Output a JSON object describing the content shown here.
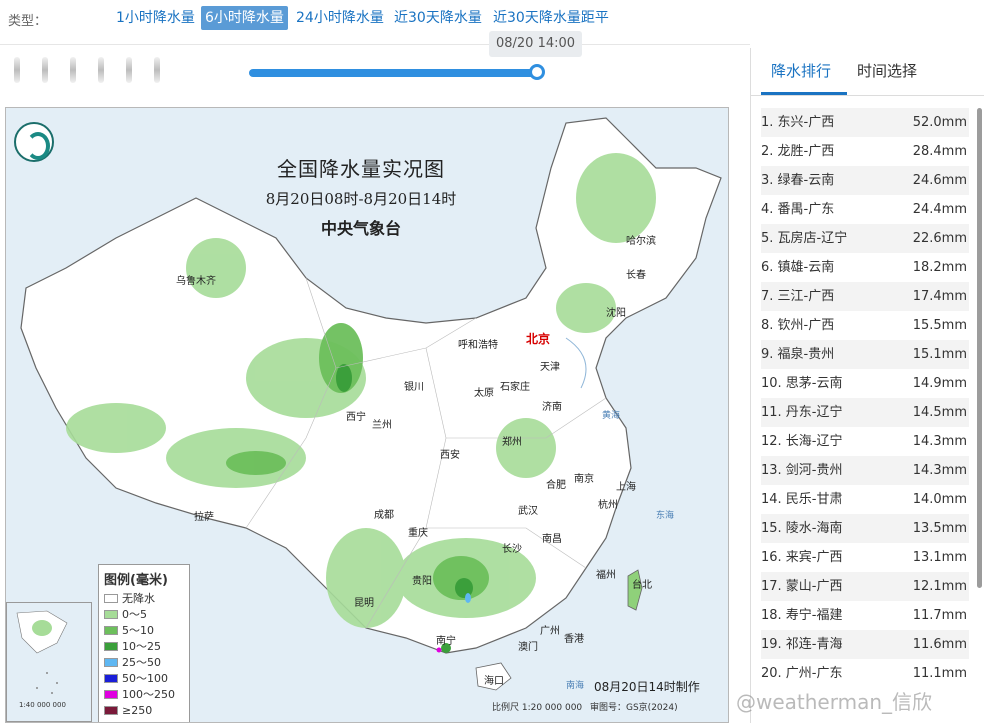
{
  "type_bar": {
    "label": "类型：",
    "tabs": [
      {
        "label": "1小时降水量",
        "active": false
      },
      {
        "label": "6小时降水量",
        "active": true
      },
      {
        "label": "24小时降水量",
        "active": false
      },
      {
        "label": "近30天降水量",
        "active": false
      },
      {
        "label": "近30天降水量距平",
        "active": false
      }
    ]
  },
  "timeline": {
    "current_time": "08/20 14:00"
  },
  "map": {
    "title": "全国降水量实况图",
    "subtitle": "8月20日08时-8月20日14时",
    "org": "中央气象台",
    "capital": "北京",
    "cities": [
      "乌鲁木齐",
      "哈尔滨",
      "长春",
      "沈阳",
      "呼和浩特",
      "天津",
      "银川",
      "太原",
      "石家庄",
      "西宁",
      "兰州",
      "济南",
      "郑州",
      "西安",
      "合肥",
      "南京",
      "上海",
      "拉萨",
      "成都",
      "武汉",
      "杭州",
      "重庆",
      "南昌",
      "长沙",
      "贵阳",
      "福州",
      "台北",
      "昆明",
      "南宁",
      "广州",
      "香港",
      "澳门",
      "海口"
    ],
    "seas": [
      "黄海",
      "东海",
      "南海"
    ],
    "legend": {
      "title": "图例(毫米)",
      "items": [
        {
          "label": "无降水",
          "color": "#ffffff"
        },
        {
          "label": "0～5",
          "color": "#a6dc98"
        },
        {
          "label": "5～10",
          "color": "#6dbf5c"
        },
        {
          "label": "10～25",
          "color": "#3b9f3b"
        },
        {
          "label": "25～50",
          "color": "#5fb7f2"
        },
        {
          "label": "50～100",
          "color": "#1a1ed8"
        },
        {
          "label": "100～250",
          "color": "#e000e0"
        },
        {
          "label": "≥250",
          "color": "#7a1a3a"
        }
      ]
    },
    "footer_note": "08月20日14时制作",
    "scale_text": "比例尺 1:20 000 000",
    "approval": "审图号：GS京(2024)",
    "inset_scale": "1:40 000 000"
  },
  "panel": {
    "tabs": [
      {
        "label": "降水排行",
        "active": true
      },
      {
        "label": "时间选择",
        "active": false
      }
    ],
    "ranking": [
      {
        "name": "1. 东兴-广西",
        "value": "52.0mm"
      },
      {
        "name": "2. 龙胜-广西",
        "value": "28.4mm"
      },
      {
        "name": "3. 绿春-云南",
        "value": "24.6mm"
      },
      {
        "name": "4. 番禺-广东",
        "value": "24.4mm"
      },
      {
        "name": "5. 瓦房店-辽宁",
        "value": "22.6mm"
      },
      {
        "name": "6. 镇雄-云南",
        "value": "18.2mm"
      },
      {
        "name": "7. 三江-广西",
        "value": "17.4mm"
      },
      {
        "name": "8. 钦州-广西",
        "value": "15.5mm"
      },
      {
        "name": "9. 福泉-贵州",
        "value": "15.1mm"
      },
      {
        "name": "10. 思茅-云南",
        "value": "14.9mm"
      },
      {
        "name": "11. 丹东-辽宁",
        "value": "14.5mm"
      },
      {
        "name": "12. 长海-辽宁",
        "value": "14.3mm"
      },
      {
        "name": "13. 剑河-贵州",
        "value": "14.3mm"
      },
      {
        "name": "14. 民乐-甘肃",
        "value": "14.0mm"
      },
      {
        "name": "15. 陵水-海南",
        "value": "13.5mm"
      },
      {
        "name": "16. 来宾-广西",
        "value": "13.1mm"
      },
      {
        "name": "17. 蒙山-广西",
        "value": "12.1mm"
      },
      {
        "name": "18. 寿宁-福建",
        "value": "11.7mm"
      },
      {
        "name": "19. 祁连-青海",
        "value": "11.6mm"
      },
      {
        "name": "20. 广州-广东",
        "value": "11.1mm"
      }
    ]
  },
  "watermark": "@weatherman_信欣"
}
